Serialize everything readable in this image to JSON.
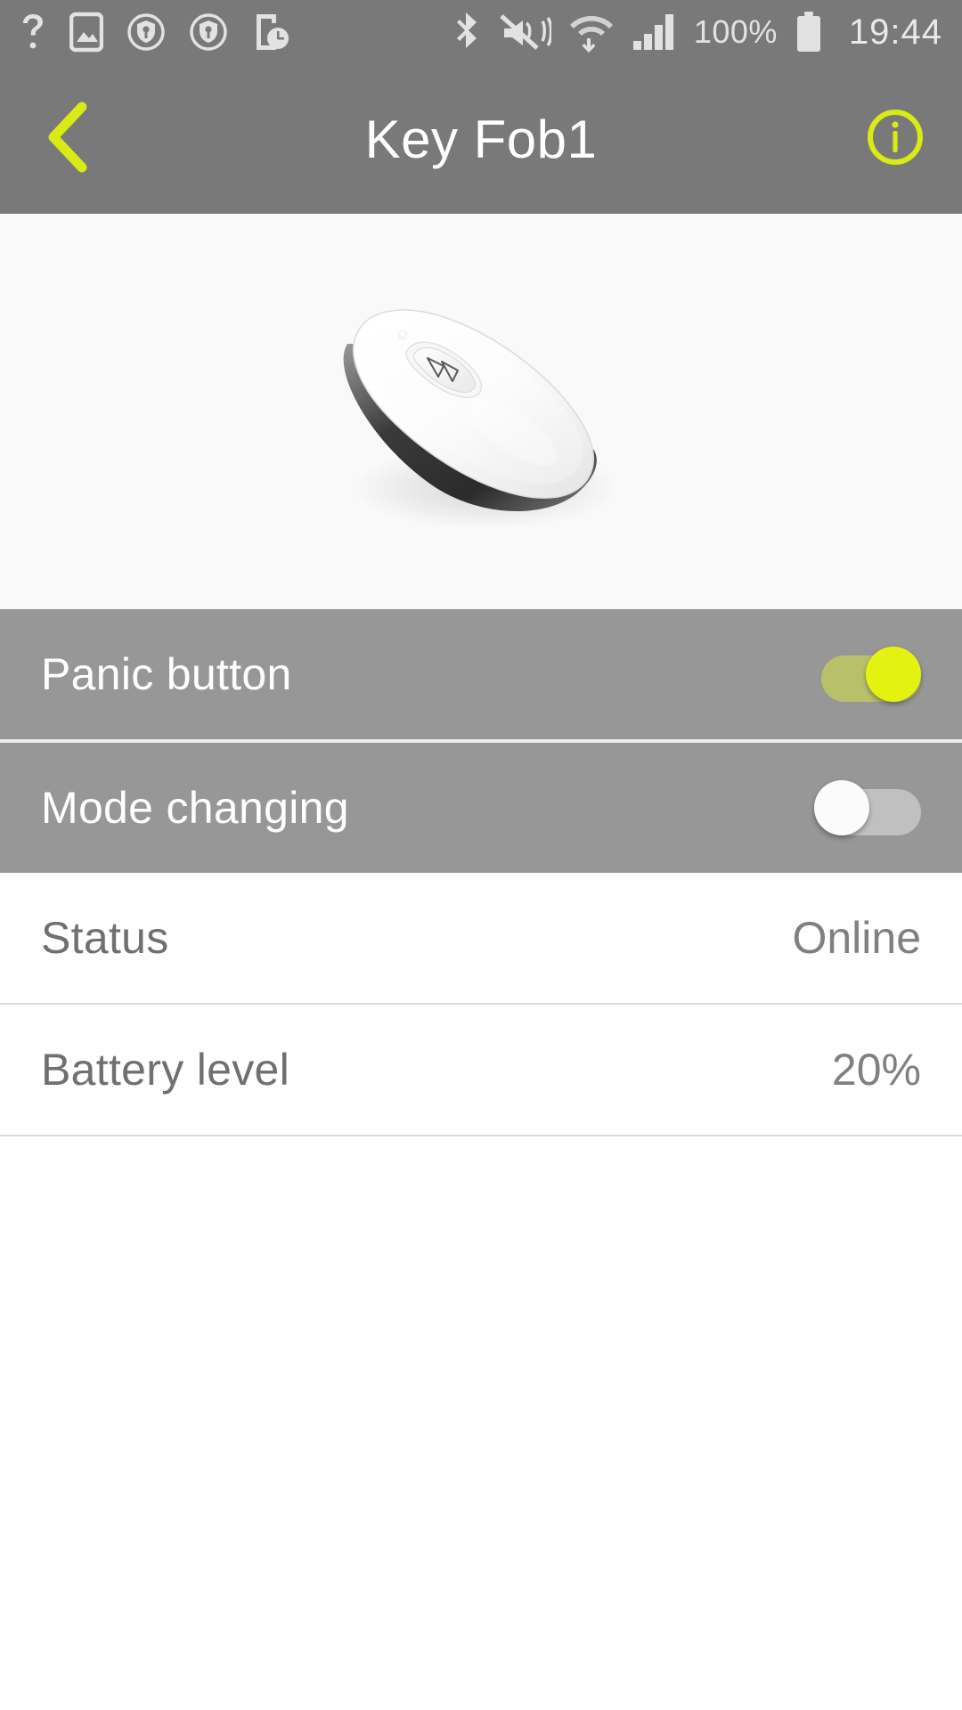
{
  "statusbar": {
    "left_icons": [
      {
        "name": "help-question-icon",
        "label": "?"
      },
      {
        "name": "screenshot-image-icon",
        "label": "image"
      },
      {
        "name": "shield-key-icon-1",
        "label": "shield"
      },
      {
        "name": "shield-key-icon-2",
        "label": "shield"
      },
      {
        "name": "phone-clock-icon",
        "label": "phone-timer"
      }
    ],
    "right_icons": [
      {
        "name": "bluetooth-icon",
        "label": "bluetooth"
      },
      {
        "name": "mute-vibrate-icon",
        "label": "silent"
      },
      {
        "name": "wifi-transfer-icon",
        "label": "wifi"
      },
      {
        "name": "cellular-signal-icon",
        "label": "signal"
      }
    ],
    "battery_percent": "100%",
    "battery_icon": "battery-full-icon",
    "clock": "19:44"
  },
  "appbar": {
    "back_icon": "chevron-left-icon",
    "title": "Key Fob1",
    "info_icon": "info-circle-icon",
    "accent_color": "#d9ea14",
    "background_color": "#797979",
    "title_color": "#ffffff"
  },
  "hero": {
    "device_name": "key-fob-device-image",
    "background_color": "#f9f9f9"
  },
  "rows": [
    {
      "key": "panic-button",
      "label": "Panic button",
      "type": "toggle",
      "state": "on",
      "background_color": "#979797"
    },
    {
      "key": "mode-changing",
      "label": "Mode changing",
      "type": "toggle",
      "state": "off",
      "background_color": "#979797"
    },
    {
      "key": "status",
      "label": "Status",
      "type": "value",
      "value": "Online",
      "background_color": "#ffffff"
    },
    {
      "key": "battery-level",
      "label": "Battery level",
      "type": "value",
      "value": "20%",
      "background_color": "#ffffff"
    }
  ],
  "colors": {
    "accent": "#e4f211",
    "header_gray": "#797979",
    "row_gray": "#979797",
    "text_gray": "#707070"
  }
}
